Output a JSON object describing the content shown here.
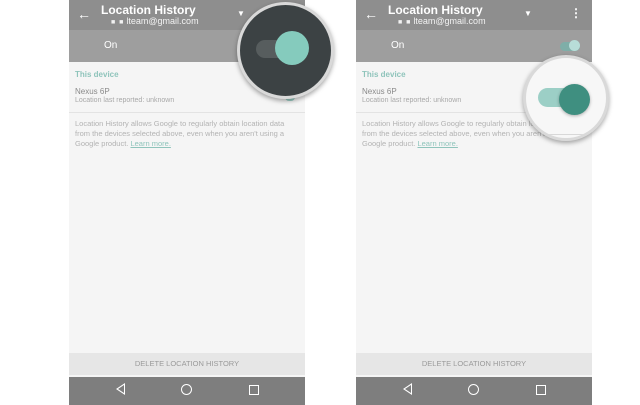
{
  "screens": [
    {
      "app_title": "Location History",
      "account_email": "lteam@gmail.com",
      "account_prefix": "■ ■",
      "on_label": "On",
      "section_header": "This device",
      "device_name": "Nexus 6P",
      "device_status": "Location last reported: unknown",
      "info_text": "Location History allows Google to regularly obtain location data from the devices selected above, even when you aren't using a Google product.",
      "learn_more": "Learn more.",
      "delete_button": "DELETE LOCATION HISTORY"
    },
    {
      "app_title": "Location History",
      "account_email": "lteam@gmail.com",
      "account_prefix": "■ ■",
      "on_label": "On",
      "section_header": "This device",
      "device_name": "Nexus 6P",
      "device_status": "Location last reported: unknown",
      "info_text": "Location History allows Google to regularly obtain location data from the devices selected above, even when you aren't using a Google product.",
      "learn_more": "Learn more.",
      "delete_button": "DELETE LOCATION HISTORY"
    }
  ],
  "icons": {
    "back": "arrow-left-icon",
    "dropdown": "caret-down-icon",
    "overflow": "more-vert-icon",
    "nav_back": "nav-back-triangle-icon",
    "nav_home": "nav-home-circle-icon",
    "nav_recent": "nav-recents-square-icon"
  },
  "colors": {
    "toggle_on_light": "#85cbbd",
    "toggle_on_dark": "#3f8f80",
    "accent_text": "#8fc4bb"
  },
  "toggle_state": {
    "left_magnified": "on",
    "right_magnified": "on"
  }
}
